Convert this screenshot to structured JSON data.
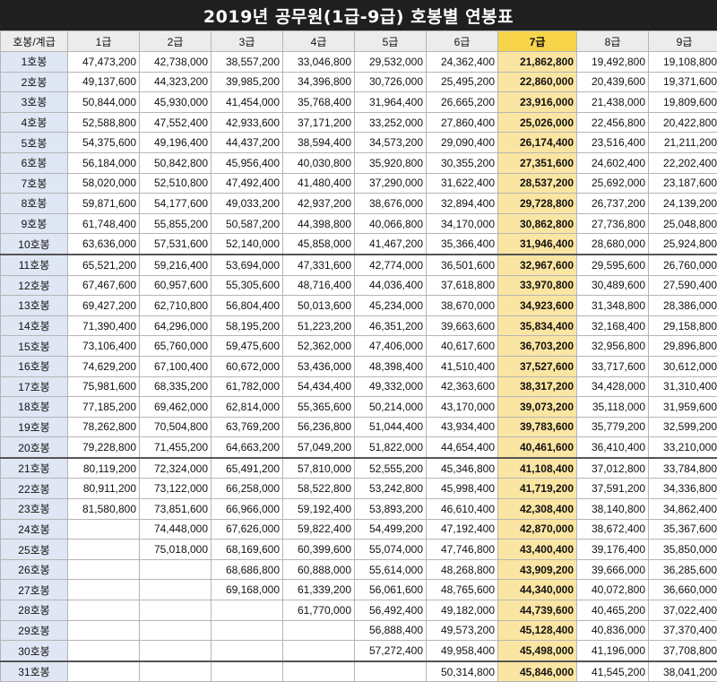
{
  "title": "2019년 공무원(1급-9급) 호봉별 연봉표",
  "colors": {
    "title_bg": "#1f1f1f",
    "highlight_header": "#f7d44a",
    "highlight_cell": "#fbe5a2",
    "row_header_bg": "#dfe6f4"
  },
  "highlight_column": "7급",
  "table": {
    "headers": [
      "호봉/계급",
      "1급",
      "2급",
      "3급",
      "4급",
      "5급",
      "6급",
      "7급",
      "8급",
      "9급"
    ],
    "rows": [
      {
        "label": "1호봉",
        "cells": [
          "47,473,200",
          "42,738,000",
          "38,557,200",
          "33,046,800",
          "29,532,000",
          "24,362,400",
          "21,862,800",
          "19,492,800",
          "19,108,800"
        ]
      },
      {
        "label": "2호봉",
        "cells": [
          "49,137,600",
          "44,323,200",
          "39,985,200",
          "34,396,800",
          "30,726,000",
          "25,495,200",
          "22,860,000",
          "20,439,600",
          "19,371,600"
        ]
      },
      {
        "label": "3호봉",
        "cells": [
          "50,844,000",
          "45,930,000",
          "41,454,000",
          "35,768,400",
          "31,964,400",
          "26,665,200",
          "23,916,000",
          "21,438,000",
          "19,809,600"
        ]
      },
      {
        "label": "4호봉",
        "cells": [
          "52,588,800",
          "47,552,400",
          "42,933,600",
          "37,171,200",
          "33,252,000",
          "27,860,400",
          "25,026,000",
          "22,456,800",
          "20,422,800"
        ]
      },
      {
        "label": "5호봉",
        "cells": [
          "54,375,600",
          "49,196,400",
          "44,437,200",
          "38,594,400",
          "34,573,200",
          "29,090,400",
          "26,174,400",
          "23,516,400",
          "21,211,200"
        ]
      },
      {
        "label": "6호봉",
        "cells": [
          "56,184,000",
          "50,842,800",
          "45,956,400",
          "40,030,800",
          "35,920,800",
          "30,355,200",
          "27,351,600",
          "24,602,400",
          "22,202,400"
        ]
      },
      {
        "label": "7호봉",
        "cells": [
          "58,020,000",
          "52,510,800",
          "47,492,400",
          "41,480,400",
          "37,290,000",
          "31,622,400",
          "28,537,200",
          "25,692,000",
          "23,187,600"
        ]
      },
      {
        "label": "8호봉",
        "cells": [
          "59,871,600",
          "54,177,600",
          "49,033,200",
          "42,937,200",
          "38,676,000",
          "32,894,400",
          "29,728,800",
          "26,737,200",
          "24,139,200"
        ]
      },
      {
        "label": "9호봉",
        "cells": [
          "61,748,400",
          "55,855,200",
          "50,587,200",
          "44,398,800",
          "40,066,800",
          "34,170,000",
          "30,862,800",
          "27,736,800",
          "25,048,800"
        ]
      },
      {
        "label": "10호봉",
        "cells": [
          "63,636,000",
          "57,531,600",
          "52,140,000",
          "45,858,000",
          "41,467,200",
          "35,366,400",
          "31,946,400",
          "28,680,000",
          "25,924,800"
        ]
      },
      {
        "label": "11호봉",
        "cells": [
          "65,521,200",
          "59,216,400",
          "53,694,000",
          "47,331,600",
          "42,774,000",
          "36,501,600",
          "32,967,600",
          "29,595,600",
          "26,760,000"
        ]
      },
      {
        "label": "12호봉",
        "cells": [
          "67,467,600",
          "60,957,600",
          "55,305,600",
          "48,716,400",
          "44,036,400",
          "37,618,800",
          "33,970,800",
          "30,489,600",
          "27,590,400"
        ]
      },
      {
        "label": "13호봉",
        "cells": [
          "69,427,200",
          "62,710,800",
          "56,804,400",
          "50,013,600",
          "45,234,000",
          "38,670,000",
          "34,923,600",
          "31,348,800",
          "28,386,000"
        ]
      },
      {
        "label": "14호봉",
        "cells": [
          "71,390,400",
          "64,296,000",
          "58,195,200",
          "51,223,200",
          "46,351,200",
          "39,663,600",
          "35,834,400",
          "32,168,400",
          "29,158,800"
        ]
      },
      {
        "label": "15호봉",
        "cells": [
          "73,106,400",
          "65,760,000",
          "59,475,600",
          "52,362,000",
          "47,406,000",
          "40,617,600",
          "36,703,200",
          "32,956,800",
          "29,896,800"
        ]
      },
      {
        "label": "16호봉",
        "cells": [
          "74,629,200",
          "67,100,400",
          "60,672,000",
          "53,436,000",
          "48,398,400",
          "41,510,400",
          "37,527,600",
          "33,717,600",
          "30,612,000"
        ]
      },
      {
        "label": "17호봉",
        "cells": [
          "75,981,600",
          "68,335,200",
          "61,782,000",
          "54,434,400",
          "49,332,000",
          "42,363,600",
          "38,317,200",
          "34,428,000",
          "31,310,400"
        ]
      },
      {
        "label": "18호봉",
        "cells": [
          "77,185,200",
          "69,462,000",
          "62,814,000",
          "55,365,600",
          "50,214,000",
          "43,170,000",
          "39,073,200",
          "35,118,000",
          "31,959,600"
        ]
      },
      {
        "label": "19호봉",
        "cells": [
          "78,262,800",
          "70,504,800",
          "63,769,200",
          "56,236,800",
          "51,044,400",
          "43,934,400",
          "39,783,600",
          "35,779,200",
          "32,599,200"
        ]
      },
      {
        "label": "20호봉",
        "cells": [
          "79,228,800",
          "71,455,200",
          "64,663,200",
          "57,049,200",
          "51,822,000",
          "44,654,400",
          "40,461,600",
          "36,410,400",
          "33,210,000"
        ]
      },
      {
        "label": "21호봉",
        "cells": [
          "80,119,200",
          "72,324,000",
          "65,491,200",
          "57,810,000",
          "52,555,200",
          "45,346,800",
          "41,108,400",
          "37,012,800",
          "33,784,800"
        ]
      },
      {
        "label": "22호봉",
        "cells": [
          "80,911,200",
          "73,122,000",
          "66,258,000",
          "58,522,800",
          "53,242,800",
          "45,998,400",
          "41,719,200",
          "37,591,200",
          "34,336,800"
        ]
      },
      {
        "label": "23호봉",
        "cells": [
          "81,580,800",
          "73,851,600",
          "66,966,000",
          "59,192,400",
          "53,893,200",
          "46,610,400",
          "42,308,400",
          "38,140,800",
          "34,862,400"
        ]
      },
      {
        "label": "24호봉",
        "cells": [
          "",
          "74,448,000",
          "67,626,000",
          "59,822,400",
          "54,499,200",
          "47,192,400",
          "42,870,000",
          "38,672,400",
          "35,367,600"
        ]
      },
      {
        "label": "25호봉",
        "cells": [
          "",
          "75,018,000",
          "68,169,600",
          "60,399,600",
          "55,074,000",
          "47,746,800",
          "43,400,400",
          "39,176,400",
          "35,850,000"
        ]
      },
      {
        "label": "26호봉",
        "cells": [
          "",
          "",
          "68,686,800",
          "60,888,000",
          "55,614,000",
          "48,268,800",
          "43,909,200",
          "39,666,000",
          "36,285,600"
        ]
      },
      {
        "label": "27호봉",
        "cells": [
          "",
          "",
          "69,168,000",
          "61,339,200",
          "56,061,600",
          "48,765,600",
          "44,340,000",
          "40,072,800",
          "36,660,000"
        ]
      },
      {
        "label": "28호봉",
        "cells": [
          "",
          "",
          "",
          "61,770,000",
          "56,492,400",
          "49,182,000",
          "44,739,600",
          "40,465,200",
          "37,022,400"
        ]
      },
      {
        "label": "29호봉",
        "cells": [
          "",
          "",
          "",
          "",
          "56,888,400",
          "49,573,200",
          "45,128,400",
          "40,836,000",
          "37,370,400"
        ]
      },
      {
        "label": "30호봉",
        "cells": [
          "",
          "",
          "",
          "",
          "57,272,400",
          "49,958,400",
          "45,498,000",
          "41,196,000",
          "37,708,800"
        ]
      },
      {
        "label": "31호봉",
        "cells": [
          "",
          "",
          "",
          "",
          "",
          "50,314,800",
          "45,846,000",
          "41,545,200",
          "38,041,200"
        ]
      }
    ]
  }
}
